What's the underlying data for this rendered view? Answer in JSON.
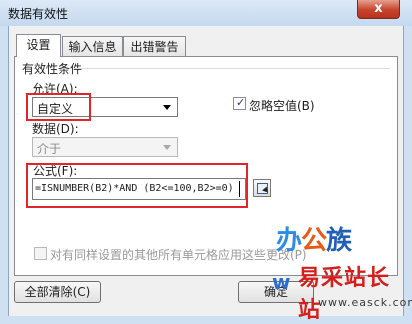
{
  "window": {
    "title": "数据有效性",
    "close_glyph": "x"
  },
  "tabs": [
    {
      "label": "设置",
      "active": true
    },
    {
      "label": "输入信息",
      "active": false
    },
    {
      "label": "出错警告",
      "active": false
    }
  ],
  "settings": {
    "section_label": "有效性条件",
    "allow": {
      "label": "允许(A):",
      "value": "自定义"
    },
    "ignore_blank": {
      "label": "忽略空值(B)",
      "checked": true
    },
    "data": {
      "label": "数据(D):",
      "value": "介于",
      "disabled": true
    },
    "formula": {
      "label": "公式(F):",
      "value": "=ISNUMBER(B2)*AND (B2<=100,B2>=0)"
    },
    "apply_all": {
      "label": "对有同样设置的其他所有单元格应用这些更改(P)",
      "checked": false,
      "disabled": true
    }
  },
  "buttons": {
    "clear_all": "全部清除(C)",
    "ok": "确定"
  },
  "watermark": {
    "logo": [
      "办",
      "公",
      "族"
    ],
    "logo_sub": "w",
    "site_name": "易采站长站",
    "url": "www.easck.com"
  },
  "colors": {
    "highlight": "#e0262b",
    "title_gradient": "#c4d8ef",
    "logo_blue": "#2a6fd0",
    "site_red": "#d4201d"
  }
}
